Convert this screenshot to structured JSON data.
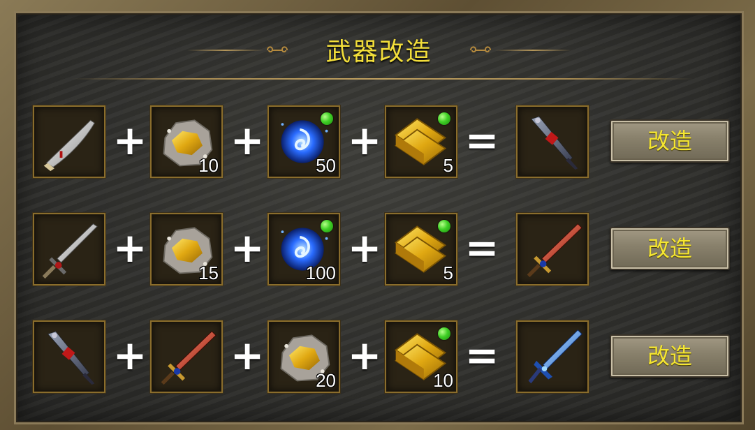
{
  "title": "武器改造",
  "recipes": [
    {
      "inputs": [
        {
          "icon": "scimitar-icon"
        },
        {
          "icon": "gold-ore-icon",
          "count": "10"
        },
        {
          "icon": "blue-soul-fire-icon",
          "count": "50",
          "green_dot": true
        },
        {
          "icon": "gold-bars-icon",
          "count": "5",
          "green_dot": true
        }
      ],
      "result": {
        "icon": "dark-greatsword-icon"
      },
      "button_label": "改造"
    },
    {
      "inputs": [
        {
          "icon": "steel-sword-icon"
        },
        {
          "icon": "gold-ore-icon",
          "count": "15"
        },
        {
          "icon": "blue-soul-fire-icon",
          "count": "100",
          "green_dot": true
        },
        {
          "icon": "gold-bars-icon",
          "count": "5",
          "green_dot": true
        }
      ],
      "result": {
        "icon": "crimson-sword-icon"
      },
      "button_label": "改造"
    },
    {
      "inputs": [
        {
          "icon": "dark-greatsword-icon"
        },
        {
          "icon": "crimson-sword-icon"
        },
        {
          "icon": "gold-ore-icon",
          "count": "20"
        },
        {
          "icon": "gold-bars-icon",
          "count": "10",
          "green_dot": true
        }
      ],
      "result": {
        "icon": "azure-sword-icon"
      },
      "button_label": "改造"
    }
  ],
  "operators": {
    "plus": "+",
    "equals": "="
  },
  "colors": {
    "title": "#f2de3a",
    "button_text": "#f5e631",
    "slot_border": "#8a6d2c",
    "badge_green": "#3fcf25"
  }
}
